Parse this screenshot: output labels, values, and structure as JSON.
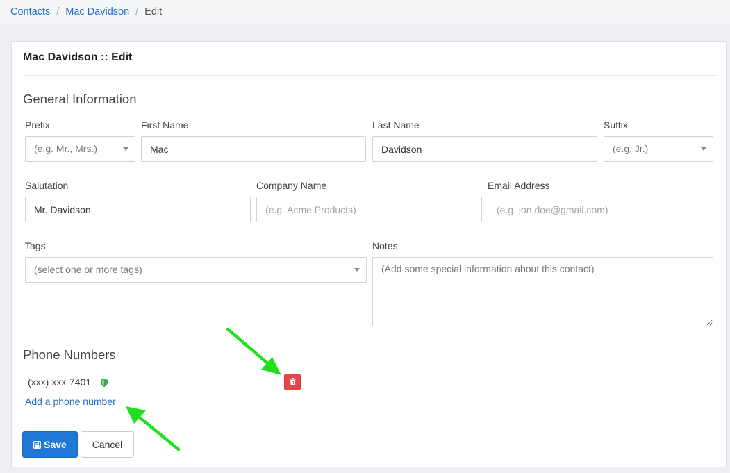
{
  "breadcrumb": {
    "items": [
      "Contacts",
      "Mac Davidson"
    ],
    "current": "Edit",
    "separator": "/"
  },
  "card": {
    "title": "Mac Davidson :: Edit"
  },
  "general": {
    "section_title": "General Information",
    "prefix": {
      "label": "Prefix",
      "placeholder": "(e.g. Mr., Mrs.)"
    },
    "first_name": {
      "label": "First Name",
      "value": "Mac"
    },
    "last_name": {
      "label": "Last Name",
      "value": "Davidson"
    },
    "suffix": {
      "label": "Suffix",
      "placeholder": "(e.g. Jr.)"
    },
    "salutation": {
      "label": "Salutation",
      "value": "Mr. Davidson"
    },
    "company": {
      "label": "Company Name",
      "placeholder": "(e.g. Acme Products)"
    },
    "email": {
      "label": "Email Address",
      "placeholder": "(e.g. jon.doe@gmail.com)"
    },
    "tags": {
      "label": "Tags",
      "placeholder": "(select one or more tags)"
    },
    "notes": {
      "label": "Notes",
      "placeholder": "(Add some special information about this contact)"
    }
  },
  "phones": {
    "section_title": "Phone Numbers",
    "items": [
      {
        "number": "(xxx) xxx-7401",
        "icon": "shield-icon"
      }
    ],
    "add_label": "Add a phone number",
    "delete_icon": "trash-icon"
  },
  "actions": {
    "save_label": "Save",
    "cancel_label": "Cancel"
  },
  "colors": {
    "link": "#1f6fc5",
    "primary": "#1f78d8",
    "danger": "#e5454b",
    "shield": "#3aa84a",
    "annotation_arrow": "#22e01e"
  }
}
